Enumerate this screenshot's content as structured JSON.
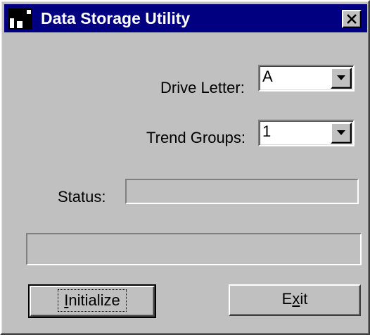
{
  "window": {
    "title": "Data Storage Utility",
    "title_bar_color": "#000080",
    "face_color": "#c0c0c0",
    "icons": {
      "app": "app-icon",
      "close": "close-icon"
    }
  },
  "form": {
    "drive_letter": {
      "label": "Drive Letter:",
      "value": "A",
      "icon": "chevron-down-icon"
    },
    "trend_groups": {
      "label": "Trend Groups:",
      "value": "1",
      "icon": "chevron-down-icon"
    },
    "status": {
      "label": "Status:",
      "value": ""
    }
  },
  "progress": {
    "value": 0
  },
  "buttons": {
    "initialize": {
      "label_before": "",
      "label_mnemonic": "I",
      "label_after": "nitialize"
    },
    "exit": {
      "label_before": "E",
      "label_mnemonic": "x",
      "label_after": "it"
    }
  }
}
